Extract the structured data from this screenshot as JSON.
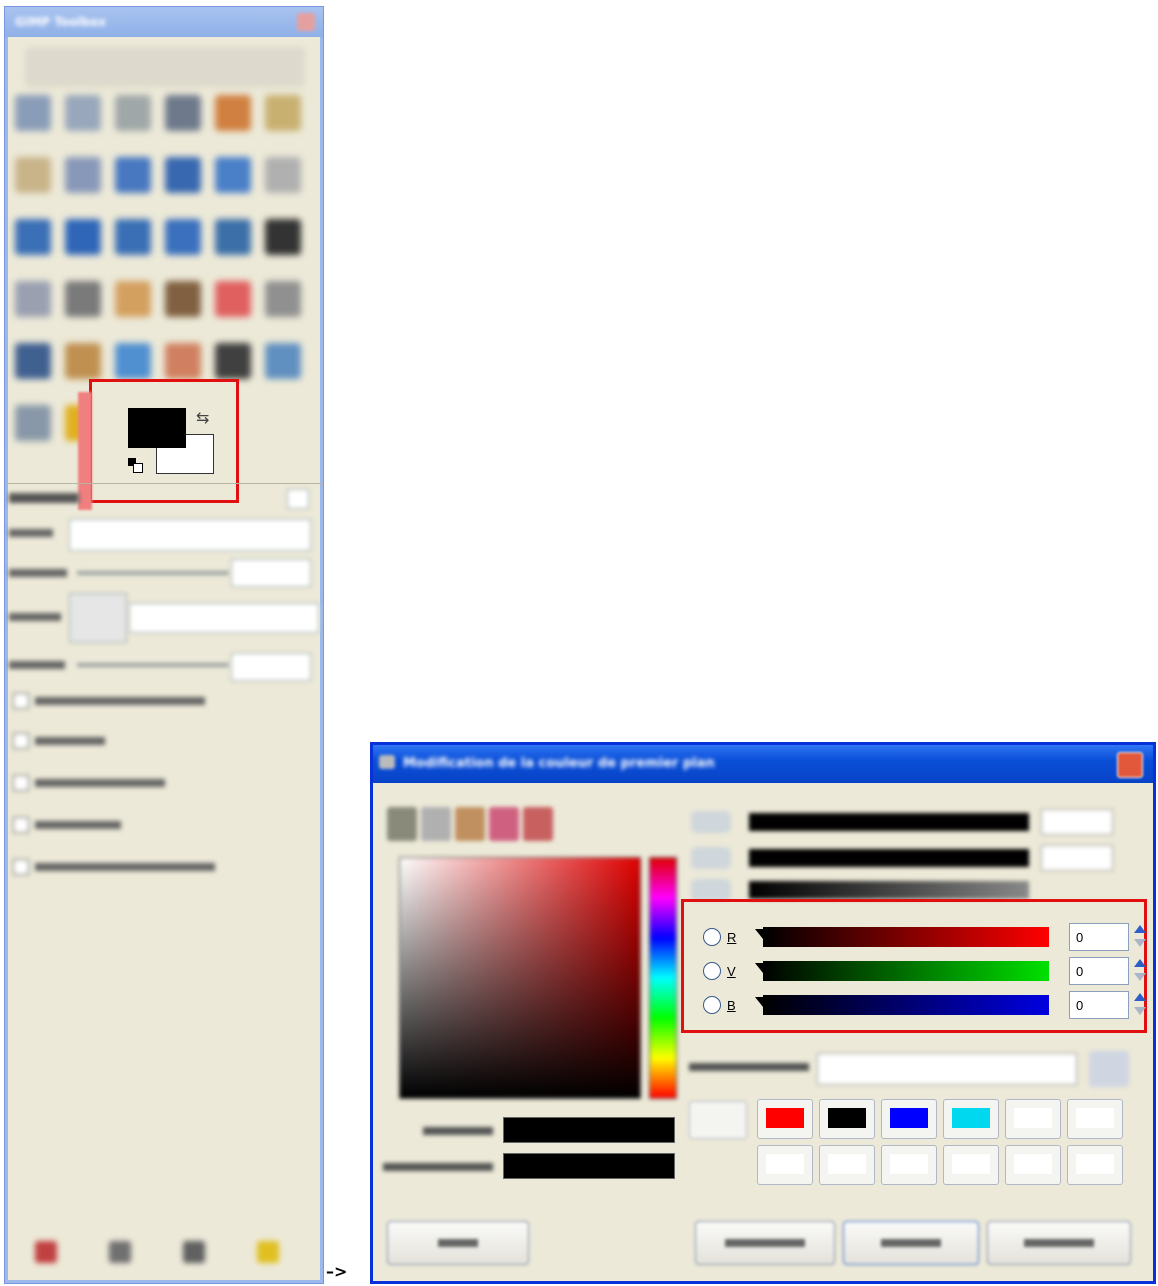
{
  "toolbox": {
    "title": "GIMP Toolbox",
    "tool_rows": [
      [
        "#8a9db8",
        "#98a7bb",
        "#a0a7a8",
        "#6e7a8c",
        "#d08040",
        "#c8b070"
      ],
      [
        "#c9b48a",
        "#8898b8",
        "#4878c0",
        "#3868b0",
        "#4a80c8",
        "#b0b0b0"
      ],
      [
        "#3b6fb6",
        "#2f66b8",
        "#3a6fb5",
        "#3a70bd",
        "#3c6fa8",
        "#333333"
      ],
      [
        "#9aa0b0",
        "#7a7a7a",
        "#d4a060",
        "#806040",
        "#e06060",
        "#909090"
      ],
      [
        "#406090",
        "#c09050",
        "#5090d0",
        "#d08060",
        "#404040",
        "#6090c0"
      ],
      [
        "#8898a8",
        "#e0b020",
        "#6080a0"
      ]
    ],
    "fg_color": "#000000",
    "bg_color": "#ffffff",
    "bottom_icon_colors": [
      "#c04040",
      "#707070",
      "#606060",
      "#e0c020"
    ]
  },
  "arrow_text": "–>",
  "dialog": {
    "title": "Modification de la couleur de premier plan",
    "rgb_rows": [
      {
        "letter": "R",
        "value": "0",
        "gradient": [
          "#000000",
          "#ff0000"
        ]
      },
      {
        "letter": "V",
        "value": "0",
        "gradient": [
          "#000000",
          "#00e000"
        ]
      },
      {
        "letter": "B",
        "value": "0",
        "gradient": [
          "#000000",
          "#0000e0"
        ]
      }
    ],
    "history_colors": [
      "#ff0000",
      "#000000",
      "#0000ff",
      "#00d8f0",
      "#ffffff",
      "#ffffff",
      "#ffffff",
      "#ffffff",
      "#ffffff",
      "#ffffff",
      "#ffffff",
      "#ffffff"
    ],
    "current_color": "#000000",
    "previous_color": "#000000"
  }
}
